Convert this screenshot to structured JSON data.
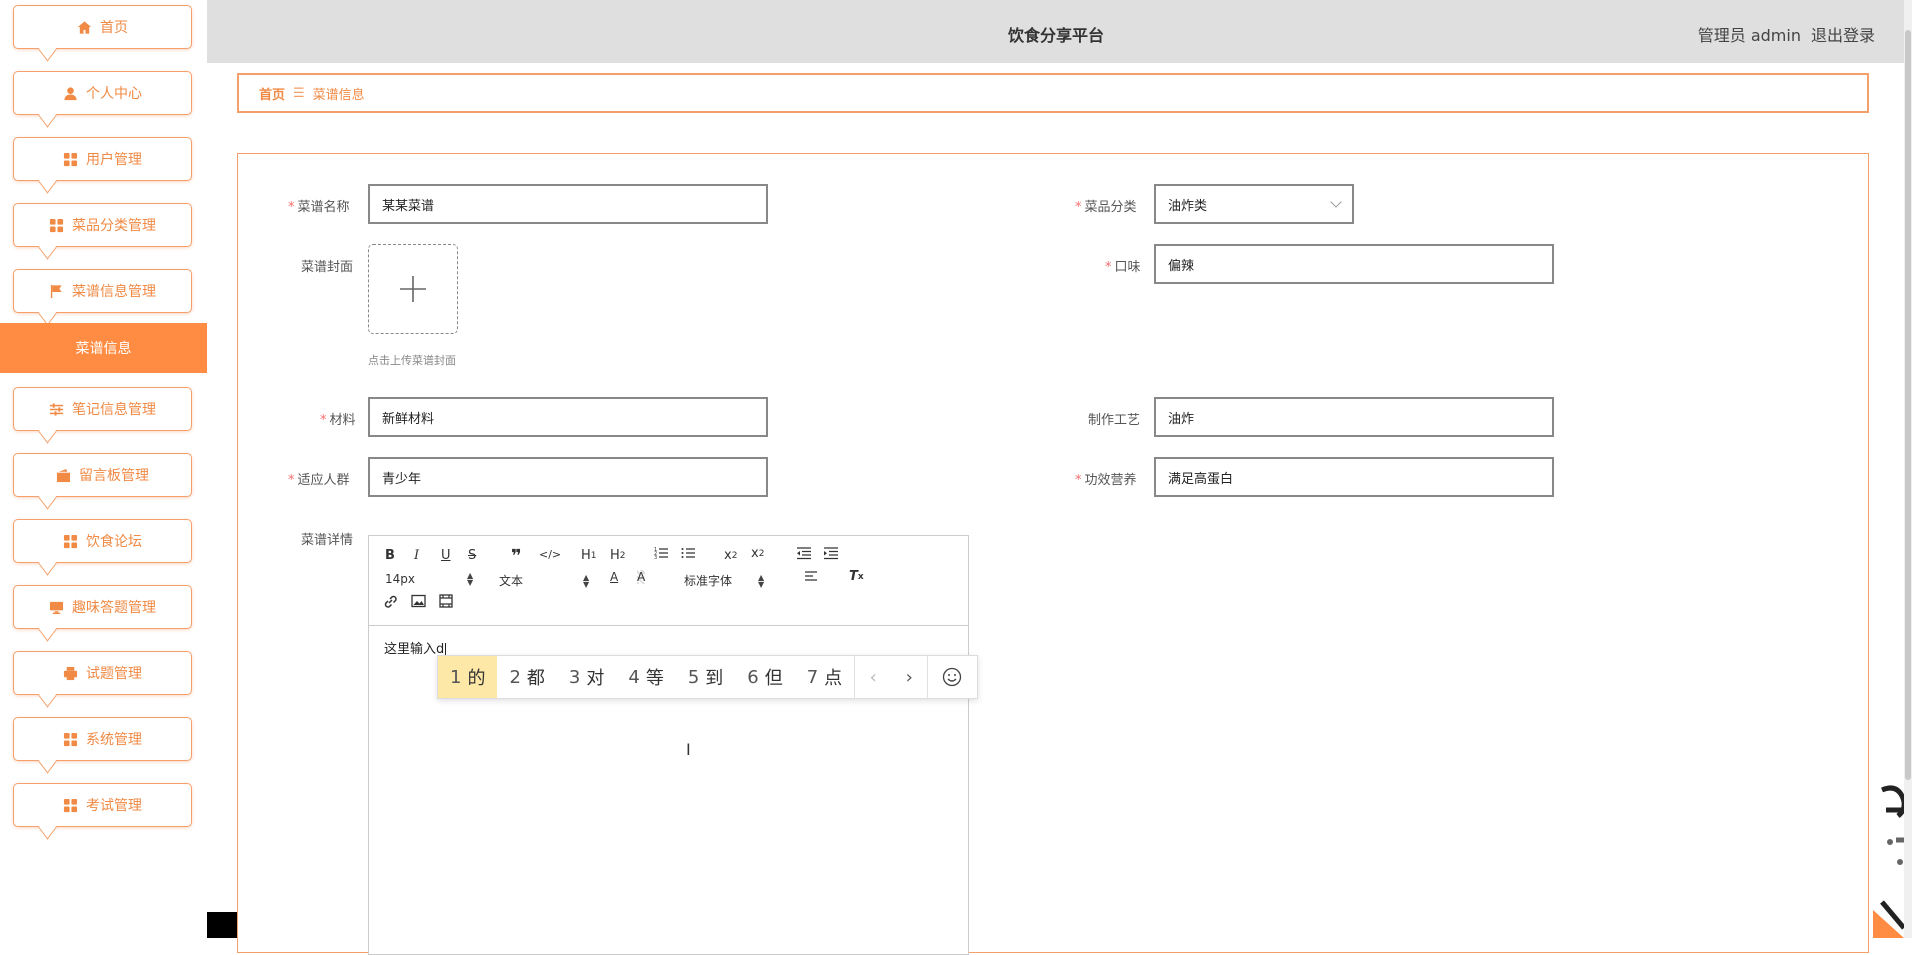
{
  "header": {
    "title": "饮食分享平台",
    "user_label": "管理员 admin",
    "logout": "退出登录"
  },
  "sidebar": {
    "items": [
      {
        "label": "首页",
        "icon": "home-icon"
      },
      {
        "label": "个人中心",
        "icon": "user-icon"
      },
      {
        "label": "用户管理",
        "icon": "grid-icon"
      },
      {
        "label": "菜品分类管理",
        "icon": "grid-icon"
      },
      {
        "label": "菜谱信息管理",
        "icon": "flag-icon"
      },
      {
        "label": "笔记信息管理",
        "icon": "sliders-icon"
      },
      {
        "label": "留言板管理",
        "icon": "wallet-icon"
      },
      {
        "label": "饮食论坛",
        "icon": "grid-icon"
      },
      {
        "label": "趣味答题管理",
        "icon": "monitor-icon"
      },
      {
        "label": "试题管理",
        "icon": "printer-icon"
      },
      {
        "label": "系统管理",
        "icon": "grid-icon"
      },
      {
        "label": "考试管理",
        "icon": "grid-icon"
      }
    ],
    "active_sub": "菜谱信息"
  },
  "breadcrumb": {
    "home": "首页",
    "separator": "☰",
    "current": "菜谱信息"
  },
  "form": {
    "name_label": "菜谱名称",
    "name_value": "某某菜谱",
    "category_label": "菜品分类",
    "category_value": "油炸类",
    "cover_label": "菜谱封面",
    "cover_tip": "点击上传菜谱封面",
    "taste_label": "口味",
    "taste_value": "偏辣",
    "material_label": "材料",
    "material_value": "新鲜材料",
    "craft_label": "制作工艺",
    "craft_value": "油炸",
    "crowd_label": "适应人群",
    "crowd_value": "青少年",
    "nutrition_label": "功效营养",
    "nutrition_value": "满足高蛋白",
    "detail_label": "菜谱详情"
  },
  "editor": {
    "size_select": "14px",
    "format_select": "文本",
    "font_select": "标准字体",
    "content": "这里输入d"
  },
  "ime": {
    "candidates": [
      {
        "num": "1",
        "word": "的"
      },
      {
        "num": "2",
        "word": "都"
      },
      {
        "num": "3",
        "word": "对"
      },
      {
        "num": "4",
        "word": "等"
      },
      {
        "num": "5",
        "word": "到"
      },
      {
        "num": "6",
        "word": "但"
      },
      {
        "num": "7",
        "word": "点"
      }
    ]
  },
  "colors": {
    "accent": "#ff8c42",
    "border": "#f5a06a",
    "header_bg": "#e0dfe0",
    "required": "#f56c6c"
  }
}
